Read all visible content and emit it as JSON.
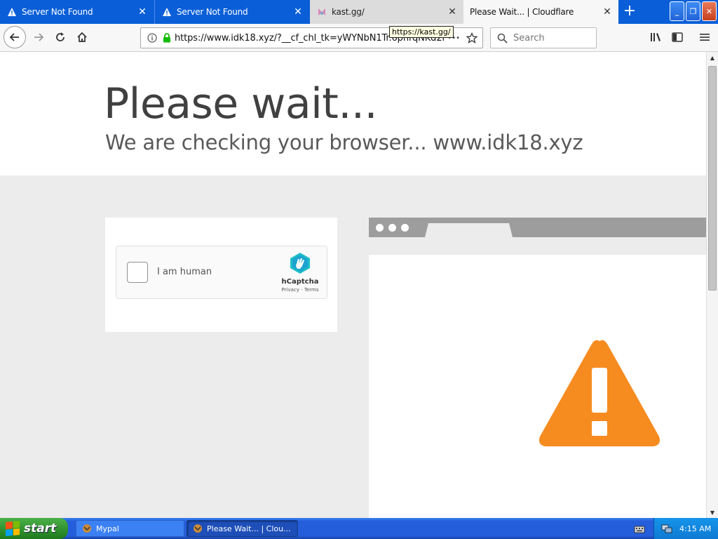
{
  "tabs": [
    {
      "label": "Server Not Found",
      "icon": "warning-icon",
      "state": "inactive"
    },
    {
      "label": "Server Not Found",
      "icon": "warning-icon",
      "state": "inactive"
    },
    {
      "label": "kast.gg/",
      "icon": "kast-favicon-icon",
      "state": "inactive-hover"
    },
    {
      "label": "Please Wait... | Cloudflare",
      "icon": "",
      "state": "active"
    }
  ],
  "new_tab_label": "+",
  "window_buttons": {
    "minimize": "_",
    "restore": "❐",
    "close": "✕"
  },
  "navbar": {
    "url": "https://www.idk18.xyz/?__cf_chl_tk=yWYNbN1Tr.6pnrqNKd2h",
    "url_more": "•••",
    "search_placeholder": "Search",
    "tooltip": "https://kast.gg/"
  },
  "page": {
    "headline": "Please wait...",
    "subheadline": "We are checking your browser... www.idk18.xyz",
    "captcha": {
      "checkbox_label": "I am human",
      "brand": "hCaptcha",
      "links": "Privacy - Terms"
    }
  },
  "taskbar": {
    "start_label": "start",
    "items": [
      {
        "label": "Mypal"
      },
      {
        "label": "Please Wait... | Clou..."
      }
    ],
    "clock": "4:15 AM"
  },
  "colors": {
    "titlebar_blue": "#0a5fd8",
    "warning_orange": "#f68b1f",
    "xp_start_green": "#2e8f2c",
    "ssl_green": "#12bc00"
  }
}
